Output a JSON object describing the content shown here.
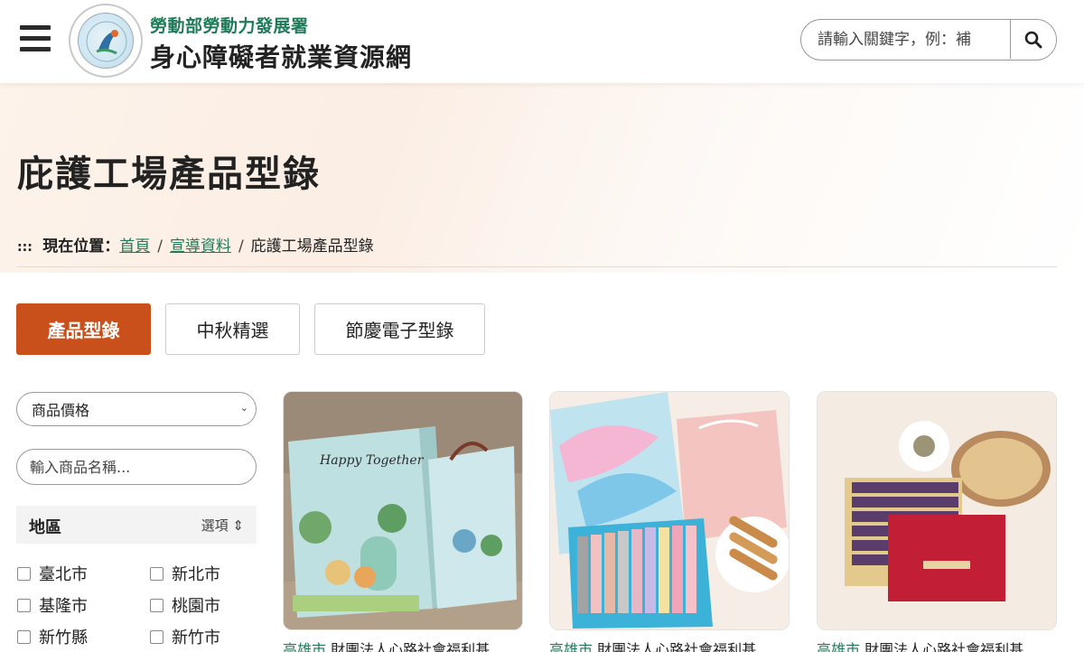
{
  "header": {
    "agency": "勞動部勞動力發展署",
    "site_title": "身心障礙者就業資源網",
    "search_placeholder": "請輸入關鍵字，例：補",
    "menu_icon": "hamburger-menu-icon",
    "search_icon": "magnifier-icon"
  },
  "page": {
    "title": "庇護工場產品型錄"
  },
  "breadcrumb": {
    "dots": ":::",
    "here_label": "現在位置：",
    "items": [
      "首頁",
      "宣導資料",
      "庇護工場產品型錄"
    ]
  },
  "tabs": [
    {
      "label": "產品型錄",
      "active": true
    },
    {
      "label": "中秋精選",
      "active": false
    },
    {
      "label": "節慶電子型錄",
      "active": false
    }
  ],
  "sidebar": {
    "price_select": "商品價格",
    "name_placeholder": "輸入商品名稱...",
    "region_title": "地區",
    "region_toggle": "選項",
    "regions": [
      "臺北市",
      "新北市",
      "基隆市",
      "桃園市",
      "新竹縣",
      "新竹市"
    ]
  },
  "products": [
    {
      "city": "高雄市",
      "org": "財團法人心路社會福利基…"
    },
    {
      "city": "高雄市",
      "org": "財團法人心路社會福利基…"
    },
    {
      "city": "高雄市",
      "org": "財團法人心路社會福利基…"
    }
  ],
  "product_image_text": {
    "happy_together": "Happy Together"
  },
  "colors": {
    "accent": "#c9501a",
    "link_green": "#1e7a58"
  }
}
